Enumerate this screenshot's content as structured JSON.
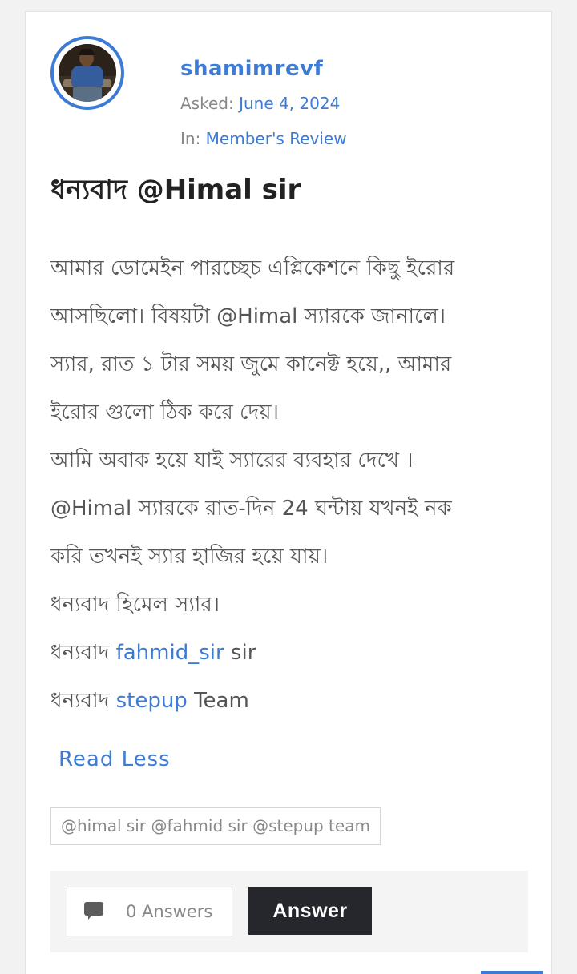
{
  "post": {
    "username": "shamimrevf",
    "asked_label": "Asked:",
    "asked_date": "June 4, 2024",
    "in_label": "In:",
    "category": "Member's Review",
    "title": "ধন্যবাদ @Himal sir",
    "body": {
      "line1": "আমার ডোমেইন পারচ্ছেচ এপ্লিকেশনে কিছু ইরোর",
      "line2": "আসছিলো। বিষয়টা @Himal স্যারকে জানালে।",
      "line3": "স্যার, রাত ১ টার সময় জুমে কানেক্ট হয়ে,, আমার",
      "line4": "ইরোর গুলো ঠিক করে দেয়।",
      "line5": "আমি অবাক হয়ে যাই স্যারের ব্যবহার দেখে ।",
      "line6": "@Himal স্যারকে রাত-দিন 24 ঘন্টায় যখনই নক",
      "line7": "করি তখনই স্যার হাজির হয়ে যায়।",
      "line8": "ধন্যবাদ হিমেল স্যার।",
      "line9_prefix": "ধন্যবাদ ",
      "line9_link": "fahmid_sir",
      "line9_suffix": " sir",
      "line10_prefix": "ধন্যবাদ ",
      "line10_link": "stepup",
      "line10_suffix": " Team"
    },
    "read_less": "Read Less",
    "tags": "@himal sir @fahmid sir @stepup team",
    "answers_count_label": "0 Answers",
    "answer_button": "Answer"
  },
  "icons": {
    "avatar": "user-avatar",
    "answers": "comment-bubble-icon"
  },
  "colors": {
    "accent": "#3d7bd5",
    "button_dark": "#25272d",
    "muted_text": "#888888"
  }
}
